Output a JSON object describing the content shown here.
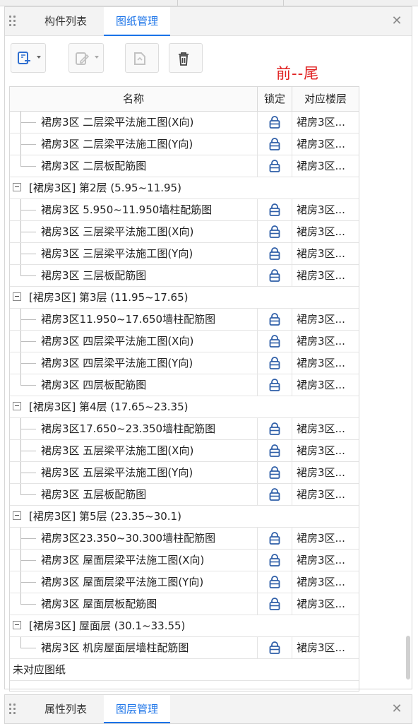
{
  "top_panel": {
    "tabs": [
      {
        "label": "构件列表",
        "active": false
      },
      {
        "label": "图纸管理",
        "active": true
      }
    ]
  },
  "toolbar": {
    "buttons": [
      {
        "icon": "add-drawing-icon",
        "has_dropdown": true
      },
      {
        "icon": "edit-drawing-icon",
        "has_dropdown": true,
        "disabled": true
      },
      {
        "icon": "copy-drawing-icon",
        "has_dropdown": false,
        "disabled": true
      },
      {
        "icon": "trash-icon",
        "has_dropdown": false
      }
    ]
  },
  "annotation": "前--尾",
  "table": {
    "headers": {
      "name": "名称",
      "lock": "锁定",
      "floor": "对应楼层"
    },
    "rows": [
      {
        "type": "child",
        "name": "裙房3区 二层梁平法施工图(X向)",
        "floor": "裙房3区..."
      },
      {
        "type": "child",
        "name": "裙房3区 二层梁平法施工图(Y向)",
        "floor": "裙房3区..."
      },
      {
        "type": "child",
        "name": "裙房3区 二层板配筋图",
        "floor": "裙房3区..."
      },
      {
        "type": "group",
        "name": "[裙房3区] 第2层 (5.95~11.95)"
      },
      {
        "type": "child",
        "name": "裙房3区 5.950~11.950墙柱配筋图",
        "floor": "裙房3区..."
      },
      {
        "type": "child",
        "name": "裙房3区 三层梁平法施工图(X向)",
        "floor": "裙房3区..."
      },
      {
        "type": "child",
        "name": "裙房3区 三层梁平法施工图(Y向)",
        "floor": "裙房3区..."
      },
      {
        "type": "child",
        "name": "裙房3区 三层板配筋图",
        "floor": "裙房3区..."
      },
      {
        "type": "group",
        "name": "[裙房3区] 第3层 (11.95~17.65)"
      },
      {
        "type": "child",
        "name": "裙房3区11.950~17.650墙柱配筋图",
        "floor": "裙房3区..."
      },
      {
        "type": "child",
        "name": "裙房3区 四层梁平法施工图(X向)",
        "floor": "裙房3区..."
      },
      {
        "type": "child",
        "name": "裙房3区 四层梁平法施工图(Y向)",
        "floor": "裙房3区..."
      },
      {
        "type": "child",
        "name": "裙房3区 四层板配筋图",
        "floor": "裙房3区..."
      },
      {
        "type": "group",
        "name": "[裙房3区] 第4层 (17.65~23.35)"
      },
      {
        "type": "child",
        "name": "裙房3区17.650~23.350墙柱配筋图",
        "floor": "裙房3区..."
      },
      {
        "type": "child",
        "name": "裙房3区 五层梁平法施工图(X向)",
        "floor": "裙房3区..."
      },
      {
        "type": "child",
        "name": "裙房3区 五层梁平法施工图(Y向)",
        "floor": "裙房3区..."
      },
      {
        "type": "child",
        "name": "裙房3区  五层板配筋图",
        "floor": "裙房3区..."
      },
      {
        "type": "group",
        "name": "[裙房3区] 第5层 (23.35~30.1)"
      },
      {
        "type": "child",
        "name": "裙房3区23.350~30.300墙柱配筋图",
        "floor": "裙房3区..."
      },
      {
        "type": "child",
        "name": "裙房3区 屋面层梁平法施工图(X向)",
        "floor": "裙房3区..."
      },
      {
        "type": "child",
        "name": "裙房3区 屋面层梁平法施工图(Y向)",
        "floor": "裙房3区..."
      },
      {
        "type": "child",
        "name": "裙房3区 屋面层板配筋图",
        "floor": "裙房3区..."
      },
      {
        "type": "group",
        "name": "[裙房3区] 屋面层 (30.1~33.55)"
      },
      {
        "type": "child",
        "name": "裙房3区 机房屋面层墙柱配筋图",
        "floor": "裙房3区..."
      },
      {
        "type": "plain",
        "name": "未对应图纸"
      }
    ]
  },
  "bottom_panel": {
    "tabs": [
      {
        "label": "属性列表",
        "active": false
      },
      {
        "label": "图层管理",
        "active": true
      }
    ]
  },
  "colors": {
    "accent": "#1a73e8",
    "annotation": "#e02020",
    "lock_icon": "#2f5fa8"
  }
}
